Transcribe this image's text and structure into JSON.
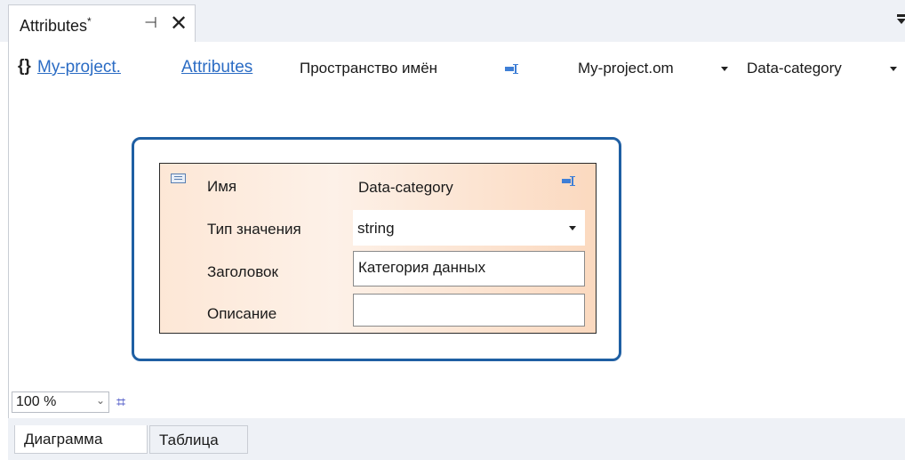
{
  "tab": {
    "title": "Attributes",
    "modified_marker": "*",
    "pin_glyph": "⊣",
    "close_glyph": "✕"
  },
  "navbar": {
    "braces": "{}",
    "project_link": "My-project.",
    "attributes_link": "Attributes",
    "namespace_label": "Пространство имён",
    "project_combo": "My-project.om",
    "category_combo": "Data-category"
  },
  "shape": {
    "name_label": "Имя",
    "name_value": "Data-category",
    "type_label": "Тип значения",
    "type_value": "string",
    "caption_label": "Заголовок",
    "caption_value": "Категория данных",
    "description_label": "Описание",
    "description_value": ""
  },
  "zoom": {
    "value": "100 %",
    "chevron": "⌄",
    "grid_glyph": "⌗"
  },
  "bottom_tabs": {
    "diagram": "Диаграмма",
    "table": "Таблица"
  },
  "colors": {
    "shape_border": "#1f5fa3",
    "link": "#2b6cc4",
    "accent_icon": "#3f7fd6"
  },
  "icons": [
    "pin-icon",
    "close-icon",
    "overflow-menu-icon",
    "property-icon",
    "dropdown-arrow-icon",
    "entity-icon",
    "grid-snap-icon"
  ]
}
